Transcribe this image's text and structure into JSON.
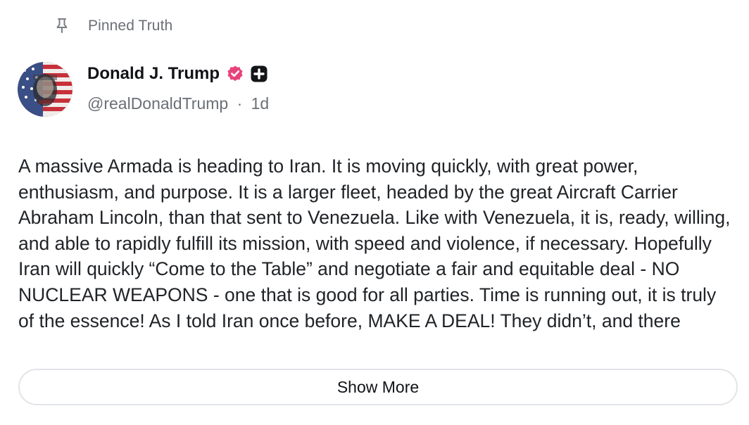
{
  "pinned": {
    "icon": "pin-icon",
    "label": "Pinned Truth"
  },
  "author": {
    "name": "Donald J. Trump",
    "verified_icon": "verified-badge-icon",
    "verified_color": "#e8437b",
    "plus_icon": "plus-badge-icon",
    "handle": "@realDonaldTrump",
    "separator": "·",
    "time": "1d"
  },
  "post": {
    "text": "A massive Armada is heading to Iran. It is moving quickly, with great power, enthusiasm, and purpose. It is a larger fleet, headed by the great Aircraft Carrier Abraham Lincoln, than that sent to Venezuela. Like with Venezuela, it is, ready, willing, and able to rapidly fulfill its mission, with speed and violence, if necessary. Hopefully Iran will quickly “Come to the Table” and negotiate a fair and equitable deal - NO NUCLEAR WEAPONS - one that is good for all parties. Time is running out, it is truly of the essence! As I told Iran once before, MAKE A DEAL! They didn’t, and there"
  },
  "actions": {
    "show_more_label": "Show More"
  }
}
